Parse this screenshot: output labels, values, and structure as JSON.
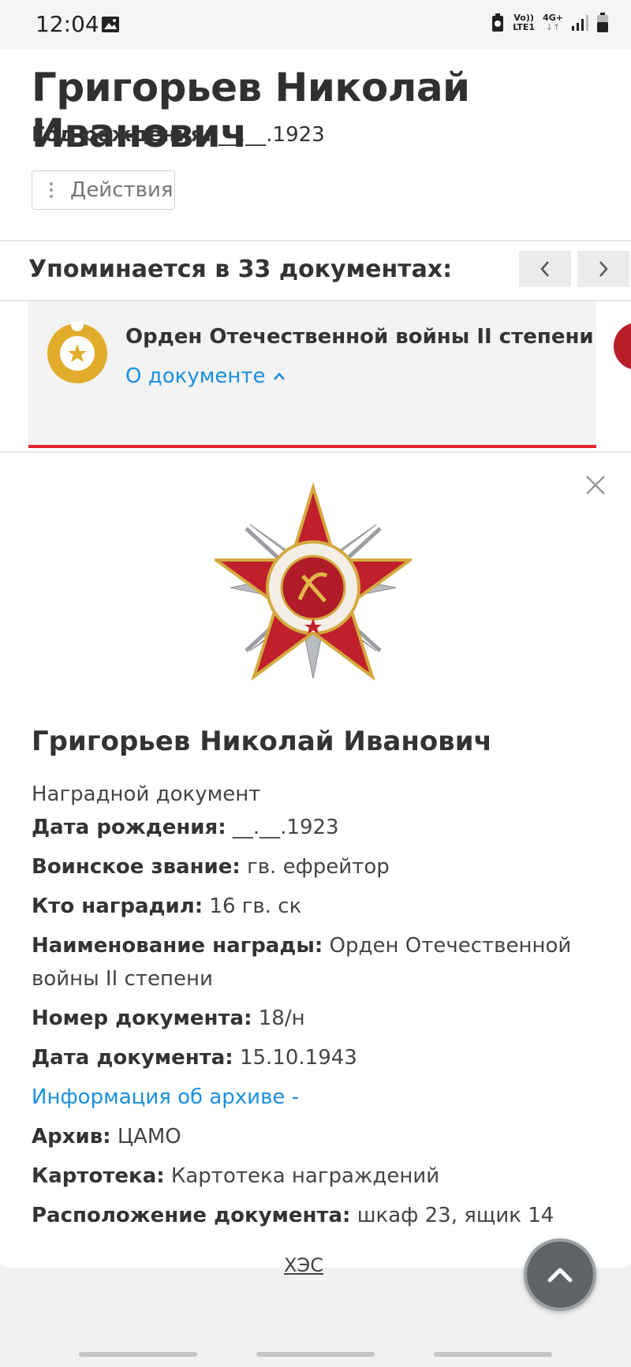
{
  "status_bar": {
    "time": "12:04",
    "network_top": "Vo))",
    "network_bottom": "LTE1",
    "signal_label": "4G+"
  },
  "person": {
    "name": "Григорьев Николай Иванович",
    "birth_label": "Год рождения:",
    "birth_value": "__.__.1923",
    "actions_label": "Действия"
  },
  "mentions": {
    "label": "Упоминается в 33 документах:"
  },
  "document_card": {
    "title": "Орден Отечественной войны II степени",
    "about_link": "О документе",
    "accent_color": "#e0252b"
  },
  "details": {
    "name": "Григорьев Николай Иванович",
    "doc_type": "Наградной документ",
    "rows": [
      {
        "label": "Дата рождения:",
        "value": "__.__.1923"
      },
      {
        "label": "Воинское звание:",
        "value": "гв. ефрейтор"
      },
      {
        "label": "Кто наградил:",
        "value": "16 гв. ск"
      },
      {
        "label": "Наименование награды:",
        "value": "Орден Отечественной войны II степени"
      },
      {
        "label": "Номер документа:",
        "value": "18/н"
      },
      {
        "label": "Дата документа:",
        "value": "15.10.1943"
      }
    ],
    "archive_link": "Информация об архиве -",
    "archive_rows": [
      {
        "label": "Архив:",
        "value": "ЦАМО"
      },
      {
        "label": "Картотека:",
        "value": "Картотека награждений"
      },
      {
        "label": "Расположение документа:",
        "value": "шкаф 23, ящик 14"
      }
    ]
  },
  "background_text": "ХЭС",
  "colors": {
    "link": "#1a8fe0",
    "medal_gold": "#e1ac2a",
    "medal_red": "#c0202c"
  }
}
